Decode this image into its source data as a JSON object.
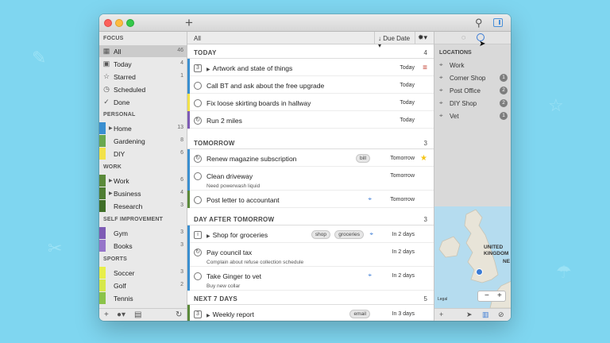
{
  "toolbar": {
    "filter_label": "All",
    "sort_label": "Due Date"
  },
  "sidebar": {
    "focus": {
      "header": "FOCUS",
      "items": [
        {
          "label": "All",
          "count": "46"
        },
        {
          "label": "Today",
          "count": "4"
        },
        {
          "label": "Starred",
          "count": "1"
        },
        {
          "label": "Scheduled",
          "count": ""
        },
        {
          "label": "Done",
          "count": ""
        }
      ]
    },
    "personal": {
      "header": "PERSONAL",
      "items": [
        {
          "label": "Home",
          "count": "13"
        },
        {
          "label": "Gardening",
          "count": "8"
        },
        {
          "label": "DIY",
          "count": "6"
        }
      ]
    },
    "work": {
      "header": "WORK",
      "items": [
        {
          "label": "Work",
          "count": "6"
        },
        {
          "label": "Business",
          "count": "4"
        },
        {
          "label": "Research",
          "count": "3"
        }
      ]
    },
    "self": {
      "header": "SELF IMPROVEMENT",
      "items": [
        {
          "label": "Gym",
          "count": "3"
        },
        {
          "label": "Books",
          "count": "3"
        }
      ]
    },
    "sports": {
      "header": "SPORTS",
      "items": [
        {
          "label": "Soccer",
          "count": "3"
        },
        {
          "label": "Golf",
          "count": "2"
        },
        {
          "label": "Tennis",
          "count": ""
        }
      ]
    }
  },
  "sections": {
    "today": {
      "title": "TODAY",
      "count": "4"
    },
    "tomorrow": {
      "title": "TOMORROW",
      "count": "3"
    },
    "dayafter": {
      "title": "DAY AFTER TOMORROW",
      "count": "3"
    },
    "next7": {
      "title": "NEXT 7 DAYS",
      "count": "5"
    }
  },
  "tasks": {
    "t1": {
      "title": "Artwork and state of things",
      "due": "Today"
    },
    "t2": {
      "title": "Call BT and ask about the free upgrade",
      "due": "Today"
    },
    "t3": {
      "title": "Fix loose skirting boards in hallway",
      "due": "Today"
    },
    "t4": {
      "title": "Run 2 miles",
      "due": "Today"
    },
    "t5": {
      "title": "Renew magazine subscription",
      "tag": "bill",
      "due": "Tomorrow"
    },
    "t6": {
      "title": "Clean driveway",
      "note": "Need powerwash liquid",
      "due": "Tomorrow"
    },
    "t7": {
      "title": "Post letter to accountant",
      "due": "Tomorrow"
    },
    "t8": {
      "title": "Shop for groceries",
      "tag1": "shop",
      "tag2": "groceries",
      "due": "In 2 days"
    },
    "t9": {
      "title": "Pay council tax",
      "note": "Complain about refuse collection schedule",
      "due": "In 2 days"
    },
    "t10": {
      "title": "Take Ginger to vet",
      "note": "Buy new collar",
      "due": "In 2 days"
    },
    "t11": {
      "title": "Weekly report",
      "tag": "email",
      "due": "In 3 days"
    }
  },
  "locations": {
    "header": "LOCATIONS",
    "items": [
      {
        "label": "Work",
        "count": ""
      },
      {
        "label": "Corner Shop",
        "count": "1"
      },
      {
        "label": "Post Office",
        "count": "2"
      },
      {
        "label": "DIY Shop",
        "count": "2"
      },
      {
        "label": "Vet",
        "count": "1"
      }
    ]
  },
  "map": {
    "label1": "UNITED",
    "label2": "KINGDOM",
    "label3": "NE",
    "legal": "Legal"
  },
  "colors": {
    "accent": "#3a7bd5",
    "green": "#5b8a3a",
    "yellow": "#f2e24a",
    "blue": "#3a8fd0",
    "purple": "#7e5bb5"
  }
}
